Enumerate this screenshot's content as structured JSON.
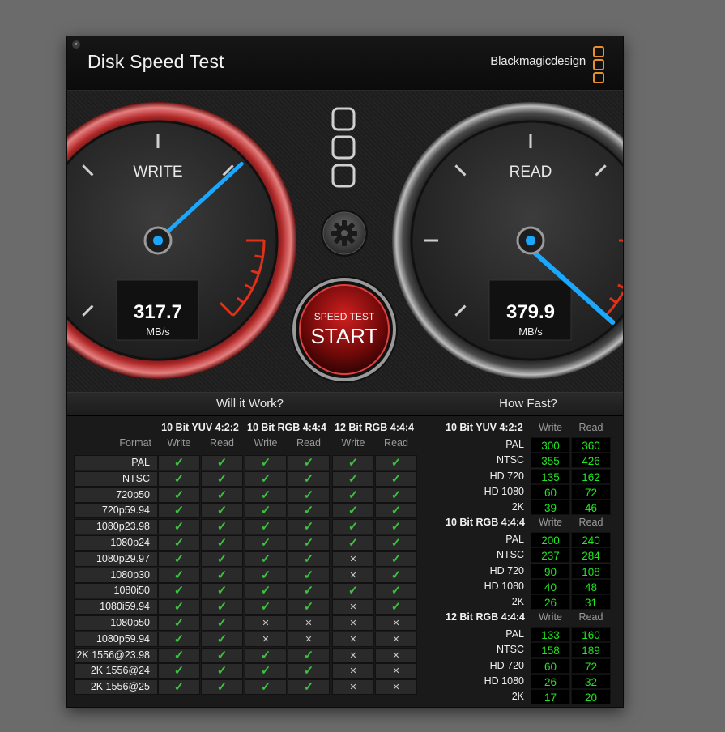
{
  "window": {
    "title": "Disk Speed Test",
    "brand": "Blackmagicdesign",
    "close_glyph": "×"
  },
  "gauges": {
    "write": {
      "label": "WRITE",
      "value": "317.7",
      "unit": "MB/s"
    },
    "read": {
      "label": "READ",
      "value": "379.9",
      "unit": "MB/s"
    }
  },
  "start_button": {
    "top": "SPEED TEST",
    "label": "START"
  },
  "settings_icon": "gear-icon",
  "will_it_work": {
    "title": "Will it Work?",
    "format_header": "Format",
    "groups": [
      "10 Bit YUV 4:2:2",
      "10 Bit RGB 4:4:4",
      "12 Bit RGB 4:4:4"
    ],
    "sub_headers": [
      "Write",
      "Read"
    ],
    "rows": [
      {
        "format": "PAL",
        "results": [
          true,
          true,
          true,
          true,
          true,
          true
        ]
      },
      {
        "format": "NTSC",
        "results": [
          true,
          true,
          true,
          true,
          true,
          true
        ]
      },
      {
        "format": "720p50",
        "results": [
          true,
          true,
          true,
          true,
          true,
          true
        ]
      },
      {
        "format": "720p59.94",
        "results": [
          true,
          true,
          true,
          true,
          true,
          true
        ]
      },
      {
        "format": "1080p23.98",
        "results": [
          true,
          true,
          true,
          true,
          true,
          true
        ]
      },
      {
        "format": "1080p24",
        "results": [
          true,
          true,
          true,
          true,
          true,
          true
        ]
      },
      {
        "format": "1080p29.97",
        "results": [
          true,
          true,
          true,
          true,
          false,
          true
        ]
      },
      {
        "format": "1080p30",
        "results": [
          true,
          true,
          true,
          true,
          false,
          true
        ]
      },
      {
        "format": "1080i50",
        "results": [
          true,
          true,
          true,
          true,
          true,
          true
        ]
      },
      {
        "format": "1080i59.94",
        "results": [
          true,
          true,
          true,
          true,
          false,
          true
        ]
      },
      {
        "format": "1080p50",
        "results": [
          true,
          true,
          false,
          false,
          false,
          false
        ]
      },
      {
        "format": "1080p59.94",
        "results": [
          true,
          true,
          false,
          false,
          false,
          false
        ]
      },
      {
        "format": "2K 1556@23.98",
        "results": [
          true,
          true,
          true,
          true,
          false,
          false
        ]
      },
      {
        "format": "2K 1556@24",
        "results": [
          true,
          true,
          true,
          true,
          false,
          false
        ]
      },
      {
        "format": "2K 1556@25",
        "results": [
          true,
          true,
          true,
          true,
          false,
          false
        ]
      }
    ]
  },
  "how_fast": {
    "title": "How Fast?",
    "sub_headers": [
      "Write",
      "Read"
    ],
    "groups": [
      {
        "name": "10 Bit YUV 4:2:2",
        "rows": [
          {
            "label": "PAL",
            "write": "300",
            "read": "360"
          },
          {
            "label": "NTSC",
            "write": "355",
            "read": "426"
          },
          {
            "label": "HD 720",
            "write": "135",
            "read": "162"
          },
          {
            "label": "HD 1080",
            "write": "60",
            "read": "72"
          },
          {
            "label": "2K",
            "write": "39",
            "read": "46"
          }
        ]
      },
      {
        "name": "10 Bit RGB 4:4:4",
        "rows": [
          {
            "label": "PAL",
            "write": "200",
            "read": "240"
          },
          {
            "label": "NTSC",
            "write": "237",
            "read": "284"
          },
          {
            "label": "HD 720",
            "write": "90",
            "read": "108"
          },
          {
            "label": "HD 1080",
            "write": "40",
            "read": "48"
          },
          {
            "label": "2K",
            "write": "26",
            "read": "31"
          }
        ]
      },
      {
        "name": "12 Bit RGB 4:4:4",
        "rows": [
          {
            "label": "PAL",
            "write": "133",
            "read": "160"
          },
          {
            "label": "NTSC",
            "write": "158",
            "read": "189"
          },
          {
            "label": "HD 720",
            "write": "60",
            "read": "72"
          },
          {
            "label": "HD 1080",
            "write": "26",
            "read": "32"
          },
          {
            "label": "2K",
            "write": "17",
            "read": "20"
          }
        ]
      }
    ]
  },
  "colors": {
    "check": "#3cc23c",
    "value": "#1fe81f",
    "needle": "#1aa8ff",
    "accent": "#e8902a",
    "redline": "#e03018"
  }
}
